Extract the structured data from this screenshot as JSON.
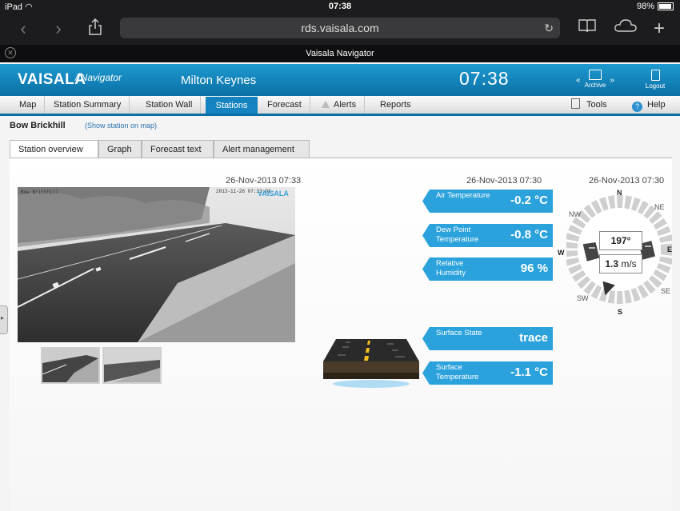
{
  "status": {
    "device": "iPad",
    "time": "07:38",
    "battery": "98%"
  },
  "browser": {
    "url": "rds.vaisala.com",
    "page_title": "Vaisala Navigator"
  },
  "header": {
    "logo": "VAISALA",
    "logo_sub": "/ Navigator",
    "location": "Milton Keynes",
    "clock": "07:38",
    "archive": "Archive",
    "logout": "Logout"
  },
  "menu": {
    "items": [
      "Map",
      "Station Summary",
      "Station Wall",
      "Stations",
      "Forecast",
      "Alerts",
      "Reports"
    ],
    "tools": "Tools",
    "help": "Help",
    "active": "Stations"
  },
  "station": {
    "name": "Bow Brickhill",
    "link": "(Show station on map)"
  },
  "tabs": [
    "Station overview",
    "Graph",
    "Forecast text",
    "Alert management"
  ],
  "camera": {
    "timestamp": "26-Nov-2013 07:33",
    "overlay_time": "2013-11-26 07:33:07",
    "watermark": "VAISALA"
  },
  "readings_timestamp": "26-Nov-2013 07:30",
  "wind_timestamp": "26-Nov-2013 07:30",
  "readings": {
    "air": {
      "label": "Air Temperature",
      "value": "-0.2 °C"
    },
    "dew": {
      "label": "Dew Point Temperature",
      "value": "-0.8 °C"
    },
    "humidity": {
      "label": "Relative Humidity",
      "value": "96 %"
    },
    "surface_state": {
      "label": "Surface State",
      "value": "trace"
    },
    "surface_temp": {
      "label": "Surface Temperature",
      "value": "-1.1 °C"
    }
  },
  "wind": {
    "direction": "197°",
    "speed": "1.3",
    "unit": "m/s",
    "labels": {
      "n": "N",
      "ne": "NE",
      "e": "E",
      "se": "SE",
      "s": "S",
      "sw": "SW",
      "w": "W",
      "nw": "NW"
    }
  },
  "colors": {
    "accent": "#1583c0",
    "reading": "#2ba2dc",
    "header": "#0a6fa5"
  }
}
